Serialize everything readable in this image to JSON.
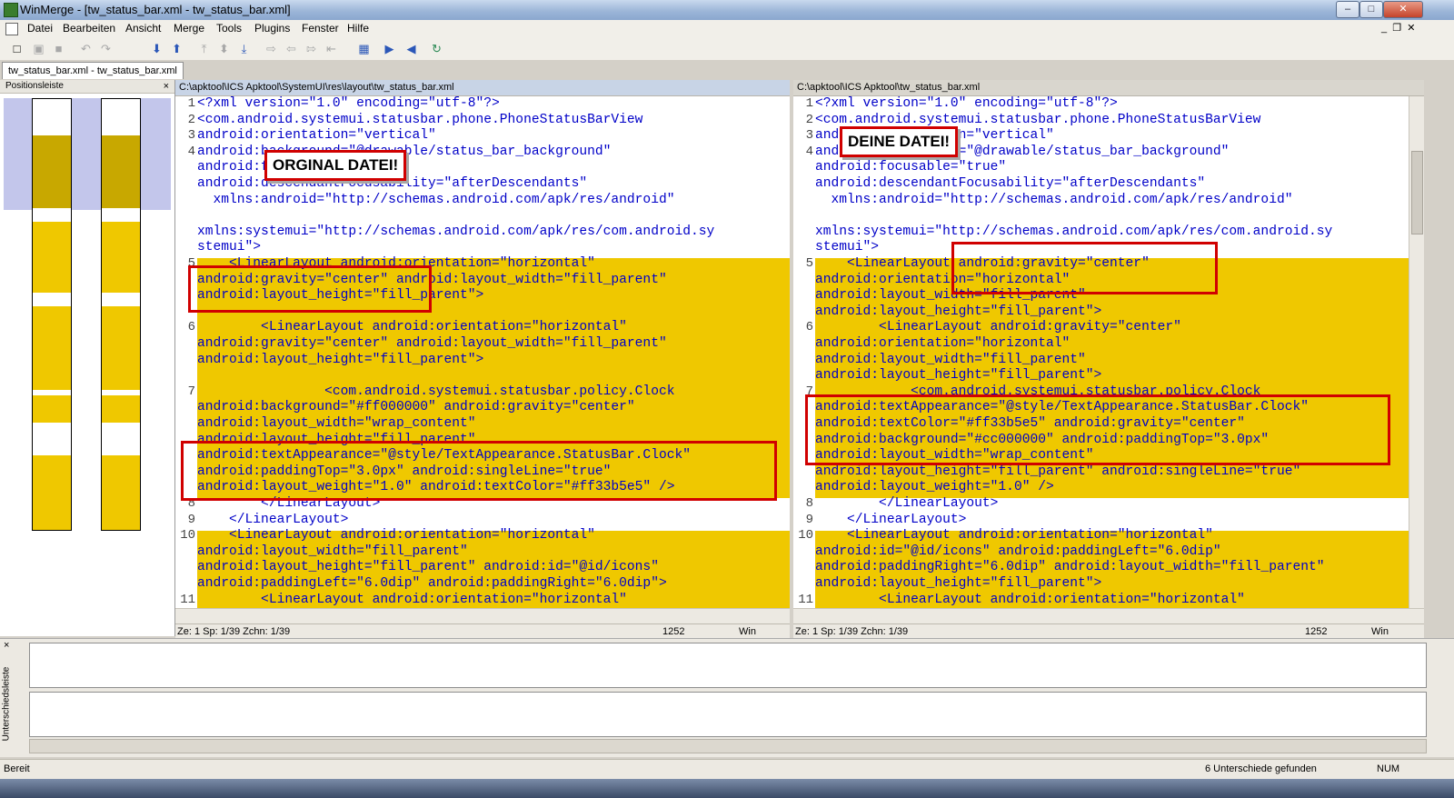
{
  "window": {
    "title": "WinMerge - [tw_status_bar.xml - tw_status_bar.xml]",
    "min_symbol": "–",
    "max_symbol": "□",
    "close_symbol": "✕"
  },
  "menu": [
    "Datei",
    "Bearbeiten",
    "Ansicht",
    "Merge",
    "Tools",
    "Plugins",
    "Fenster",
    "Hilfe"
  ],
  "doc_tab": "tw_status_bar.xml - tw_status_bar.xml",
  "location_pane": {
    "title": "Positionsleiste",
    "close": "×"
  },
  "left": {
    "path": "C:\\apktool\\ICS Apktool\\SystemUI\\res\\layout\\tw_status_bar.xml",
    "callout": "ORGINAL DATEI!",
    "line_numbers": [
      "1",
      "2",
      "3",
      "4",
      "5",
      "6",
      "7",
      "8",
      "9",
      "10",
      "11"
    ],
    "lines": [
      "<?xml version=\"1.0\" encoding=\"utf-8\"?>",
      "<com.android.systemui.statusbar.phone.PhoneStatusBarView",
      "android:orientation=\"vertical\"",
      "android:background=\"@drawable/status_bar_background\"",
      "android:focusable=\"true\"",
      "android:descendantFocusability=\"afterDescendants\"",
      "  xmlns:android=\"http://schemas.android.com/apk/res/android\"",
      "",
      "xmlns:systemui=\"http://schemas.android.com/apk/res/com.android.sy",
      "stemui\">",
      "    <LinearLayout android:orientation=\"horizontal\"",
      "android:gravity=\"center\" android:layout_width=\"fill_parent\"",
      "android:layout_height=\"fill_parent\">",
      "",
      "        <LinearLayout android:orientation=\"horizontal\"",
      "android:gravity=\"center\" android:layout_width=\"fill_parent\"",
      "android:layout_height=\"fill_parent\">",
      "",
      "                <com.android.systemui.statusbar.policy.Clock",
      "android:background=\"#ff000000\" android:gravity=\"center\"",
      "android:layout_width=\"wrap_content\"",
      "android:layout_height=\"fill_parent\"",
      "android:textAppearance=\"@style/TextAppearance.StatusBar.Clock\"",
      "android:paddingTop=\"3.0px\" android:singleLine=\"true\"",
      "android:layout_weight=\"1.0\" android:textColor=\"#ff33b5e5\" />",
      "        </LinearLayout>",
      "    </LinearLayout>",
      "    <LinearLayout android:orientation=\"horizontal\"",
      "android:layout_width=\"fill_parent\"",
      "android:layout_height=\"fill_parent\" android:id=\"@id/icons\"",
      "android:paddingLeft=\"6.0dip\" android:paddingRight=\"6.0dip\">",
      "        <LinearLayout android:orientation=\"horizontal\""
    ],
    "status": {
      "pos": "Ze: 1  Sp: 1/39  Zchn: 1/39",
      "cp": "1252",
      "eol": "Win"
    }
  },
  "right": {
    "path": "C:\\apktool\\ICS Apktool\\tw_status_bar.xml",
    "callout": "DEINE DATEI!",
    "line_numbers": [
      "1",
      "2",
      "3",
      "4",
      "5",
      "6",
      "7",
      "8",
      "9",
      "10",
      "11"
    ],
    "lines": [
      "<?xml version=\"1.0\" encoding=\"utf-8\"?>",
      "<com.android.systemui.statusbar.phone.PhoneStatusBarView",
      "android:orientation=\"vertical\"",
      "android:background=\"@drawable/status_bar_background\"",
      "android:focusable=\"true\"",
      "android:descendantFocusability=\"afterDescendants\"",
      "  xmlns:android=\"http://schemas.android.com/apk/res/android\"",
      "",
      "xmlns:systemui=\"http://schemas.android.com/apk/res/com.android.sy",
      "stemui\">",
      "    <LinearLayout android:gravity=\"center\"",
      "android:orientation=\"horizontal\"",
      "android:layout_width=\"fill_parent\"",
      "android:layout_height=\"fill_parent\">",
      "        <LinearLayout android:gravity=\"center\"",
      "android:orientation=\"horizontal\"",
      "android:layout_width=\"fill_parent\"",
      "android:layout_height=\"fill_parent\">",
      "            <com.android.systemui.statusbar.policy.Clock",
      "android:textAppearance=\"@style/TextAppearance.StatusBar.Clock\"",
      "android:textColor=\"#ff33b5e5\" android:gravity=\"center\"",
      "android:background=\"#cc000000\" android:paddingTop=\"3.0px\"",
      "android:layout_width=\"wrap_content\"",
      "android:layout_height=\"fill_parent\" android:singleLine=\"true\"",
      "android:layout_weight=\"1.0\" />",
      "        </LinearLayout>",
      "    </LinearLayout>",
      "    <LinearLayout android:orientation=\"horizontal\"",
      "android:id=\"@id/icons\" android:paddingLeft=\"6.0dip\"",
      "android:paddingRight=\"6.0dip\" android:layout_width=\"fill_parent\"",
      "android:layout_height=\"fill_parent\">",
      "        <LinearLayout android:orientation=\"horizontal\""
    ],
    "status": {
      "pos": "Ze: 1  Sp: 1/39  Zchn: 1/39",
      "cp": "1252",
      "eol": "Win"
    }
  },
  "diff_pane": {
    "label": "Unterschiedsleiste",
    "close": "×"
  },
  "statusbar": {
    "left": "Bereit",
    "diffs": "6 Unterschiede gefunden",
    "num": "NUM"
  },
  "colors": {
    "diff_highlight": "#efc800",
    "code_text": "#0000c8",
    "callout_border": "#d00000"
  }
}
